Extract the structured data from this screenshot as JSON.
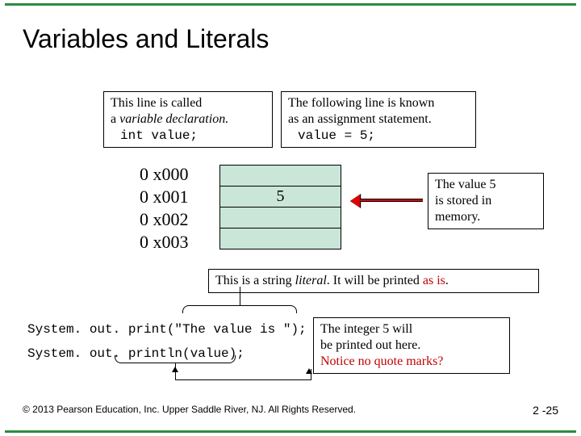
{
  "title": "Variables and Literals",
  "box_left": {
    "line1": "This line is called",
    "line2_prefix": "a ",
    "line2_italic": "variable declaration.",
    "code": "int value;"
  },
  "box_right": {
    "line1": "The following line is known",
    "line2": "as an assignment  statement.",
    "code": "value = 5;"
  },
  "memory": {
    "addresses": [
      "0 x000",
      "0 x001",
      "0 x002",
      "0 x003"
    ],
    "stored_value": "5"
  },
  "box_mem": {
    "line1": "The value 5",
    "line2": "is stored in",
    "line3": "memory."
  },
  "box_literal": {
    "t1": "This is a string ",
    "t2_italic": "literal",
    "t3": ". It will be printed ",
    "t4_red": "as is",
    "t5": "."
  },
  "code": {
    "line1": "System. out. print(\"The value is \");",
    "line2": "System. out. println(value);"
  },
  "box_int": {
    "l1": "The integer 5 will",
    "l2": "be printed out here.",
    "l3_red": "Notice no quote marks?"
  },
  "footer": {
    "left": "© 2013 Pearson Education, Inc. Upper Saddle River, NJ. All Rights Reserved.",
    "right": "2 -25"
  }
}
